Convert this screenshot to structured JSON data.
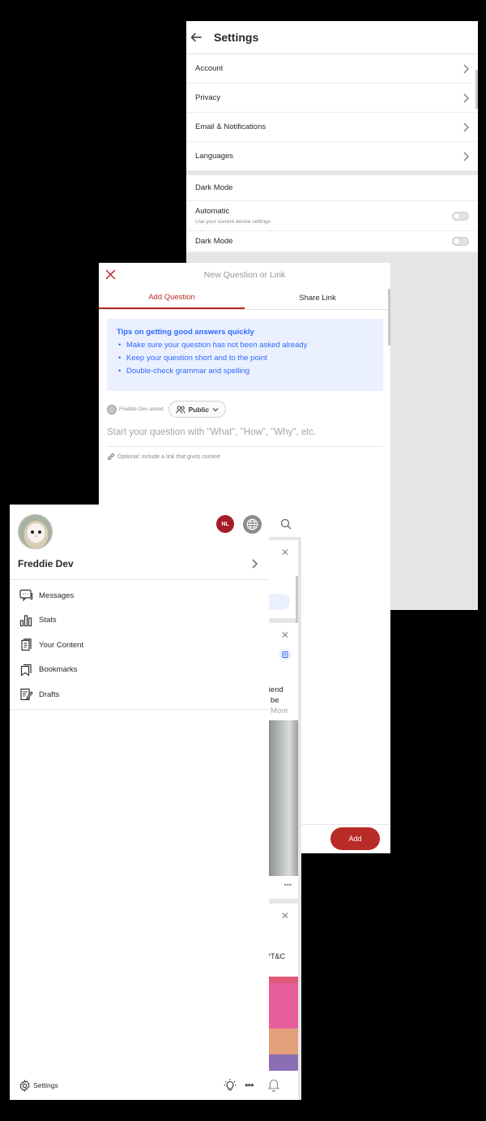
{
  "settings": {
    "title": "Settings",
    "rows": [
      {
        "label": "Account"
      },
      {
        "label": "Privacy"
      },
      {
        "label": "Email & Notifications"
      },
      {
        "label": "Languages"
      }
    ],
    "dark_mode_section": "Dark Mode",
    "automatic": {
      "label": "Automatic",
      "sub": "Use your current device settings",
      "on": false
    },
    "dark_mode": {
      "label": "Dark Mode",
      "on": false
    }
  },
  "question_modal": {
    "title": "New Question or Link",
    "tabs": [
      "Add Question",
      "Share Link"
    ],
    "active_tab": "Add Question",
    "tips": {
      "title": "Tips on getting good answers quickly",
      "items": [
        "Make sure your question has not been asked already",
        "Keep your question short and to the point",
        "Double-check grammar and spelling"
      ]
    },
    "asked_by": "Freddie Dev asked",
    "audience": "Public",
    "question_placeholder": "Start your question with \"What\", \"How\", \"Why\", etc.",
    "link_placeholder": "Optional: include a link that gives context",
    "add_button": "Add"
  },
  "feed_fragments": {
    "f1": "friend",
    "f2": "o be",
    "f3": "d More",
    "f4": "l *T&C"
  },
  "drawer": {
    "user_name": "Freddie Dev",
    "language_badge": "NL",
    "menu": [
      {
        "label": "Messages",
        "icon": "messages-icon"
      },
      {
        "label": "Stats",
        "icon": "stats-icon"
      },
      {
        "label": "Your Content",
        "icon": "content-icon"
      },
      {
        "label": "Bookmarks",
        "icon": "bookmark-icon"
      },
      {
        "label": "Drafts",
        "icon": "drafts-icon"
      }
    ],
    "settings_label": "Settings",
    "more_label": "•••"
  },
  "colors": {
    "accent": "#b92b27",
    "tip_blue": "#2e69ff",
    "tip_bg": "#ebf0ff"
  }
}
